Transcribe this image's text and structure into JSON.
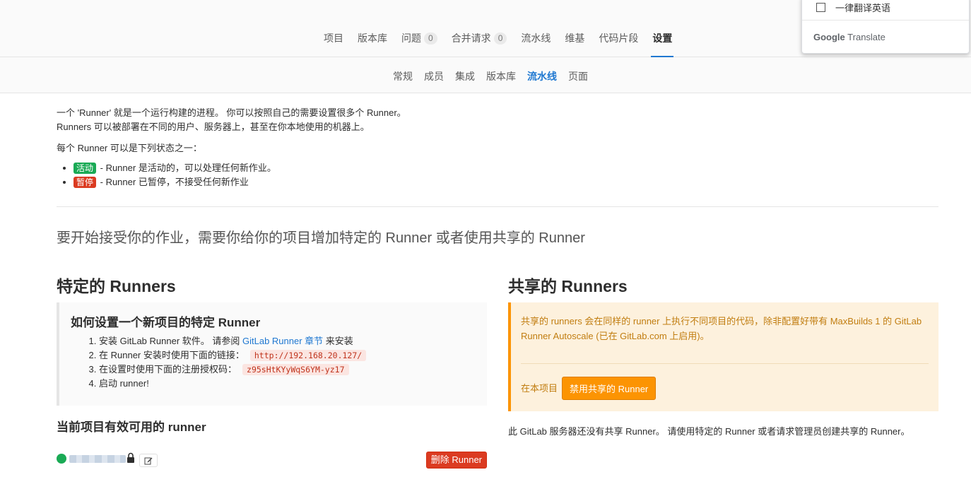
{
  "top_nav": {
    "tabs": [
      {
        "label": "项目"
      },
      {
        "label": "版本库"
      },
      {
        "label": "问题",
        "count": "0"
      },
      {
        "label": "合并请求",
        "count": "0"
      },
      {
        "label": "流水线"
      },
      {
        "label": "维基"
      },
      {
        "label": "代码片段"
      },
      {
        "label": "设置"
      }
    ]
  },
  "sub_nav": {
    "tabs": [
      {
        "label": "常规"
      },
      {
        "label": "成员"
      },
      {
        "label": "集成"
      },
      {
        "label": "版本库"
      },
      {
        "label": "流水线"
      },
      {
        "label": "页面"
      }
    ]
  },
  "translate_popup": {
    "option_label": "一律翻译英语",
    "brand_google": "Google",
    "brand_translate": "Translate"
  },
  "intro": {
    "line1": "一个 'Runner' 就是一个运行构建的进程。 你可以按照自己的需要设置很多个 Runner。",
    "line2": "Runners 可以被部署在不同的用户、服务器上，甚至在你本地使用的机器上。",
    "states_title": "每个 Runner 可以是下列状态之一：",
    "active_label": "活动",
    "active_desc": " - Runner 是活动的，可以处理任何新作业。",
    "paused_label": "暂停",
    "paused_desc": " - Runner 已暂停，不接受任何新作业"
  },
  "lead": "要开始接受你的作业，需要你给你的项目增加特定的 Runner 或者使用共享的 Runner",
  "specific": {
    "title": "特定的 Runners",
    "box_title": "如何设置一个新项目的特定 Runner",
    "step1_prefix": "安装 GitLab Runner 软件。 请参阅 ",
    "step1_link": "GitLab Runner 章节",
    "step1_suffix": " 来安装",
    "step2_prefix": "在 Runner 安装时使用下面的链接：",
    "step2_code": "http://192.168.20.127/",
    "step3_prefix": "在设置时使用下面的注册授权码：",
    "step3_code": "z95sHtKYyWqS6YM-yz17",
    "step4": "启动 runner!",
    "available_title": "当前项目有效可用的 runner",
    "delete_label": "删除 Runner"
  },
  "shared": {
    "title": "共享的 Runners",
    "info": "共享的 runners 会在同样的 runner 上执行不同项目的代码，除非配置好带有 MaxBuilds 1 的 GitLab Runner Autoscale (已在 GitLab.com 上启用)。",
    "in_project": "在本项目",
    "disable_button": "禁用共享的 Runner",
    "note": "此 GitLab 服务器还没有共享 Runner。 请使用特定的 Runner 或者请求管理员创建共享的 Runner。"
  },
  "colors": {
    "primary": "#1f78d1",
    "success": "#1aaa55",
    "danger": "#db3b21",
    "warning": "#fc9403"
  }
}
